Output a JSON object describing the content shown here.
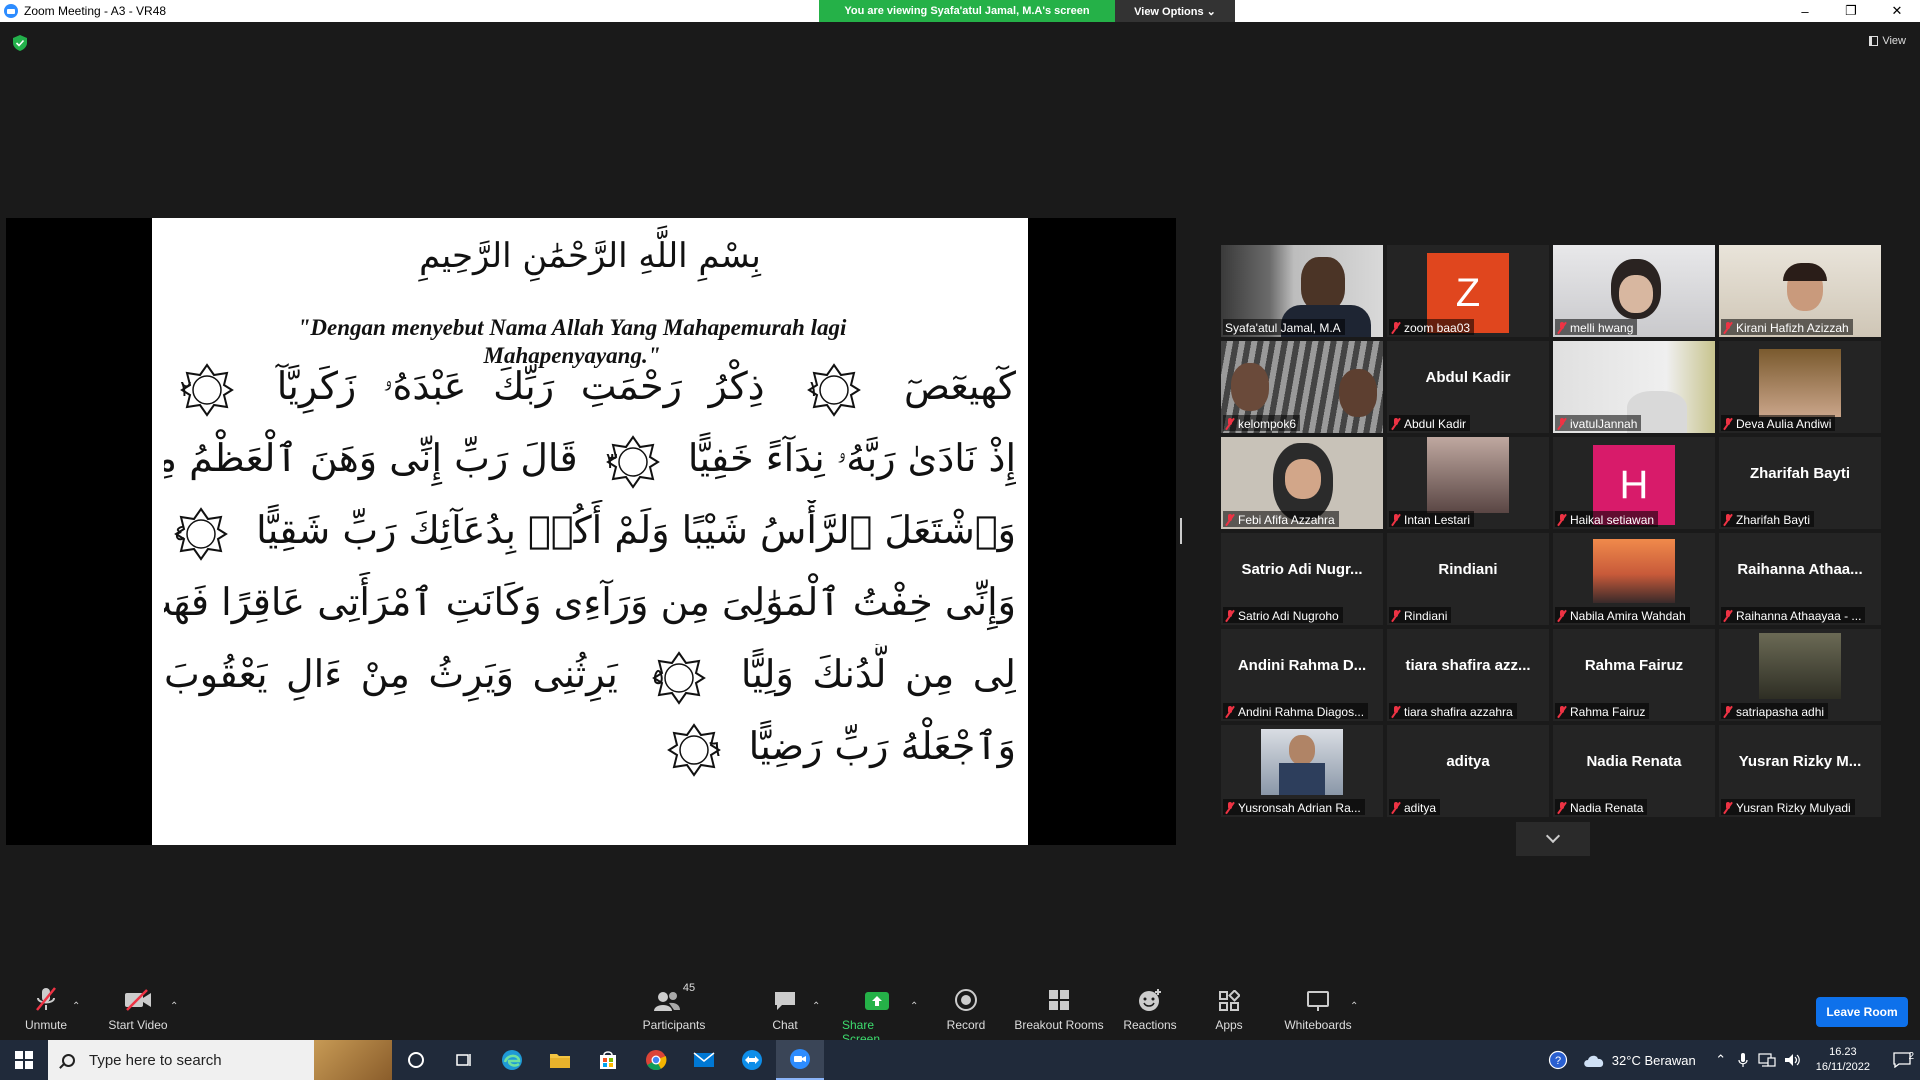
{
  "window": {
    "title": "Zoom Meeting - A3 - VR48"
  },
  "banner": {
    "viewing_text": "You are viewing Syafa'atul Jamal, M.A's screen",
    "view_options_label": "View Options ⌄"
  },
  "top_right": {
    "view_label": "View"
  },
  "shared_screen": {
    "bismillah": "بِسْمِ اللَّهِ الرَّحْمَٰنِ الرَّحِيمِ",
    "translation": "\"Dengan menyebut Nama Allah Yang Mahapemurah lagi Mahapenyayang.\"",
    "lines": [
      {
        "text_a": "كٓهيعٓصٓ",
        "mark_a": "١",
        "text_b": "ذِكْرُ رَحْمَتِ رَبِّكَ عَبْدَهُۥ زَكَرِيَّآ",
        "mark_b": "٢"
      },
      {
        "text_a": "إِذْ نَادَىٰ رَبَّهُۥ نِدَآءً خَفِيًّا",
        "mark_a": "٣",
        "text_b": "قَالَ رَبِّ إِنِّى وَهَنَ ٱلْعَظْمُ مِنِّى",
        "mark_b": ""
      },
      {
        "text_a": "وَٱشْتَعَلَ ٱلرَّأْسُ شَيْبًا وَلَمْ أَكُنۢ بِدُعَآئِكَ رَبِّ شَقِيًّا",
        "mark_a": "٤",
        "text_b": "",
        "mark_b": ""
      },
      {
        "text_a": "وَإِنِّى خِفْتُ ٱلْمَوَٰلِىَ مِن وَرَآءِى وَكَانَتِ ٱمْرَأَتِى عَاقِرًا فَهَبْ",
        "mark_a": "",
        "text_b": "",
        "mark_b": ""
      },
      {
        "text_a": "لِى مِن لَّدُنكَ وَلِيًّا",
        "mark_a": "٥",
        "text_b": "يَرِثُنِى وَيَرِثُ مِنْ ءَالِ يَعْقُوبَ",
        "mark_b": ""
      },
      {
        "text_a": "وَٱجْعَلْهُ رَبِّ رَضِيًّا",
        "mark_a": "٦",
        "text_b": "",
        "mark_b": ""
      }
    ]
  },
  "participants_tiles": [
    {
      "name": "Syafa'atul Jamal, M.A",
      "big_name": "",
      "kind": "video",
      "active": true,
      "muted": false
    },
    {
      "name": "zoom baa03",
      "big_name": "",
      "kind": "letter",
      "letter": "Z",
      "letter_color": "#e0461e",
      "muted": true
    },
    {
      "name": "melli hwang",
      "big_name": "",
      "kind": "video",
      "muted": true
    },
    {
      "name": "Kirani Hafizh Azizzah",
      "big_name": "",
      "kind": "video",
      "muted": true
    },
    {
      "name": "kelompok6",
      "big_name": "",
      "kind": "video",
      "muted": true
    },
    {
      "name": "Abdul Kadir",
      "big_name": "Abdul Kadir",
      "kind": "name",
      "muted": true
    },
    {
      "name": "ivatulJannah",
      "big_name": "",
      "kind": "video",
      "muted": true
    },
    {
      "name": "Deva Aulia Andiwi",
      "big_name": "",
      "kind": "photo",
      "muted": true
    },
    {
      "name": "Febi Afifa Azzahra",
      "big_name": "",
      "kind": "video",
      "muted": true
    },
    {
      "name": "Intan Lestari",
      "big_name": "",
      "kind": "photo",
      "muted": true
    },
    {
      "name": "Haikal setiawan",
      "big_name": "",
      "kind": "letter",
      "letter": "H",
      "letter_color": "#d81b6a",
      "muted": true
    },
    {
      "name": "Zharifah Bayti",
      "big_name": "Zharifah Bayti",
      "kind": "name",
      "muted": true
    },
    {
      "name": "Satrio Adi Nugroho",
      "big_name": "Satrio Adi Nugr...",
      "kind": "name",
      "muted": true
    },
    {
      "name": "Rindiani",
      "big_name": "Rindiani",
      "kind": "name",
      "muted": true
    },
    {
      "name": "Nabila Amira Wahdah",
      "big_name": "",
      "kind": "photo",
      "muted": true
    },
    {
      "name": "Raihanna Athaayaa - ...",
      "big_name": "Raihanna Athaa...",
      "kind": "name",
      "muted": true
    },
    {
      "name": "Andini Rahma Diagos...",
      "big_name": "Andini Rahma D...",
      "kind": "name",
      "muted": true
    },
    {
      "name": "tiara shafira azzahra",
      "big_name": "tiara shafira azz...",
      "kind": "name",
      "muted": true
    },
    {
      "name": "Rahma Fairuz",
      "big_name": "Rahma Fairuz",
      "kind": "name",
      "muted": true
    },
    {
      "name": "satriapasha adhi",
      "big_name": "",
      "kind": "photo",
      "muted": true
    },
    {
      "name": "Yusronsah Adrian Ra...",
      "big_name": "",
      "kind": "photo",
      "muted": true
    },
    {
      "name": "aditya",
      "big_name": "aditya",
      "kind": "name",
      "muted": true
    },
    {
      "name": "Nadia Renata",
      "big_name": "Nadia Renata",
      "kind": "name",
      "muted": true
    },
    {
      "name": "Yusran Rizky Mulyadi",
      "big_name": "Yusran Rizky M...",
      "kind": "name",
      "muted": true
    }
  ],
  "toolbar": {
    "unmute": "Unmute",
    "start_video": "Start Video",
    "participants": "Participants",
    "participants_count": "45",
    "chat": "Chat",
    "share_screen": "Share Screen",
    "record": "Record",
    "breakout_rooms": "Breakout Rooms",
    "reactions": "Reactions",
    "apps": "Apps",
    "whiteboards": "Whiteboards",
    "leave": "Leave Room"
  },
  "taskbar": {
    "search_placeholder": "Type here to search",
    "weather": "32°C  Berawan",
    "time": "16.23",
    "date": "16/11/2022",
    "notification_count": "2"
  },
  "colors": {
    "share_green": "#25b148",
    "active_outline": "#d4e84a",
    "leave_blue": "#0e71eb",
    "accent_green_label": "#3ddc6e"
  }
}
